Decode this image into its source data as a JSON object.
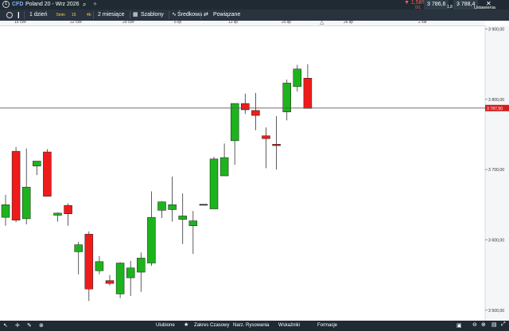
{
  "topbar": {
    "instrument_tag": "CFD",
    "instrument_name": "Poland 20 - Wrz 2026",
    "change_percent": "1,58%",
    "change_sub": "0/1",
    "bid": "3 786,6",
    "spread": "1,8",
    "ask": "3 788,4",
    "settings_label": "Ustawienia"
  },
  "toolbar": {
    "timeframe_label": "1 dzień",
    "mini_a": "5min",
    "mini_b": "15",
    "mini_c": "4h",
    "range_label": "2 miesiące",
    "templates_label": "Szablony",
    "averages_label": "Średkowa",
    "related_label": "Powiązane"
  },
  "bottombar": {
    "favourites_label": "Ulubione",
    "time_range_label": "Zakres Czasowy",
    "drawing_tools_label": "Narz. Rysowania",
    "indicators_label": "Wskaźniki",
    "patterns_label": "Formacje"
  },
  "colors": {
    "bullish": "#1db31d",
    "bearish": "#ef1b1b",
    "price_marker": "#d41d1d"
  },
  "chart_data": {
    "type": "candlestick",
    "x_tick_labels": [
      "15 cze",
      "22 cze",
      "29 cze",
      "6 lip",
      "13 lip",
      "20 lip",
      "26 lip",
      "2 sie"
    ],
    "y_tick_labels": [
      "3 900,00",
      "3 800,00",
      "3 700,00",
      "3 600,00",
      "3 500,00"
    ],
    "y_ticks": [
      3900,
      3800,
      3700,
      3600,
      3500
    ],
    "ylim": [
      3485,
      3905
    ],
    "current_price": 3787.5,
    "current_price_label": "3 787,50",
    "candles": [
      {
        "o": 3632,
        "h": 3664,
        "l": 3620,
        "c": 3650
      },
      {
        "o": 3726,
        "h": 3732,
        "l": 3625,
        "c": 3628
      },
      {
        "o": 3630,
        "h": 3730,
        "l": 3622,
        "c": 3675
      },
      {
        "o": 3705,
        "h": 3712,
        "l": 3692,
        "c": 3712
      },
      {
        "o": 3725,
        "h": 3729,
        "l": 3662,
        "c": 3662
      },
      {
        "o": 3635,
        "h": 3639,
        "l": 3626,
        "c": 3638
      },
      {
        "o": 3649,
        "h": 3652,
        "l": 3620,
        "c": 3637
      },
      {
        "o": 3583,
        "h": 3597,
        "l": 3551,
        "c": 3593
      },
      {
        "o": 3608,
        "h": 3612,
        "l": 3513,
        "c": 3530
      },
      {
        "o": 3556,
        "h": 3577,
        "l": 3551,
        "c": 3569
      },
      {
        "o": 3542,
        "h": 3550,
        "l": 3535,
        "c": 3538
      },
      {
        "o": 3523,
        "h": 3568,
        "l": 3517,
        "c": 3567
      },
      {
        "o": 3546,
        "h": 3570,
        "l": 3520,
        "c": 3560
      },
      {
        "o": 3554,
        "h": 3582,
        "l": 3526,
        "c": 3574
      },
      {
        "o": 3567,
        "h": 3669,
        "l": 3563,
        "c": 3632
      },
      {
        "o": 3642,
        "h": 3655,
        "l": 3631,
        "c": 3654
      },
      {
        "o": 3643,
        "h": 3690,
        "l": 3626,
        "c": 3650
      },
      {
        "o": 3629,
        "h": 3666,
        "l": 3594,
        "c": 3634
      },
      {
        "o": 3620,
        "h": 3641,
        "l": 3580,
        "c": 3627
      },
      {
        "o": 3650,
        "h": 3650,
        "l": 3650,
        "c": 3650
      },
      {
        "o": 3644,
        "h": 3718,
        "l": 3644,
        "c": 3715
      },
      {
        "o": 3691,
        "h": 3737,
        "l": 3691,
        "c": 3717
      },
      {
        "o": 3741,
        "h": 3793,
        "l": 3707,
        "c": 3794
      },
      {
        "o": 3794,
        "h": 3808,
        "l": 3779,
        "c": 3785
      },
      {
        "o": 3784,
        "h": 3809,
        "l": 3756,
        "c": 3777
      },
      {
        "o": 3748,
        "h": 3760,
        "l": 3702,
        "c": 3744
      },
      {
        "o": 3736,
        "h": 3776,
        "l": 3700,
        "c": 3734
      },
      {
        "o": 3782,
        "h": 3828,
        "l": 3770,
        "c": 3823
      },
      {
        "o": 3818,
        "h": 3849,
        "l": 3811,
        "c": 3843
      },
      {
        "o": 3830,
        "h": 3850,
        "l": 3787,
        "c": 3787
      }
    ]
  }
}
